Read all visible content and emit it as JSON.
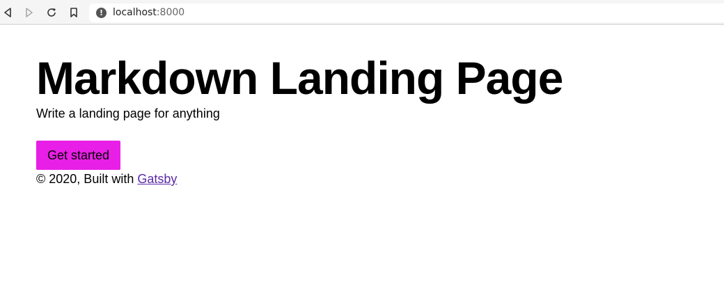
{
  "browser": {
    "url_host": "localhost",
    "url_port": ":8000",
    "info_icon": "!"
  },
  "hero": {
    "title": "Markdown Landing Page",
    "subtitle": "Write a landing page for anything",
    "cta_label": "Get started"
  },
  "footer": {
    "text": "© 2020, Built with ",
    "link_label": "Gatsby"
  },
  "colors": {
    "cta_background": "#e81fe6",
    "link": "#5b2aa8"
  }
}
